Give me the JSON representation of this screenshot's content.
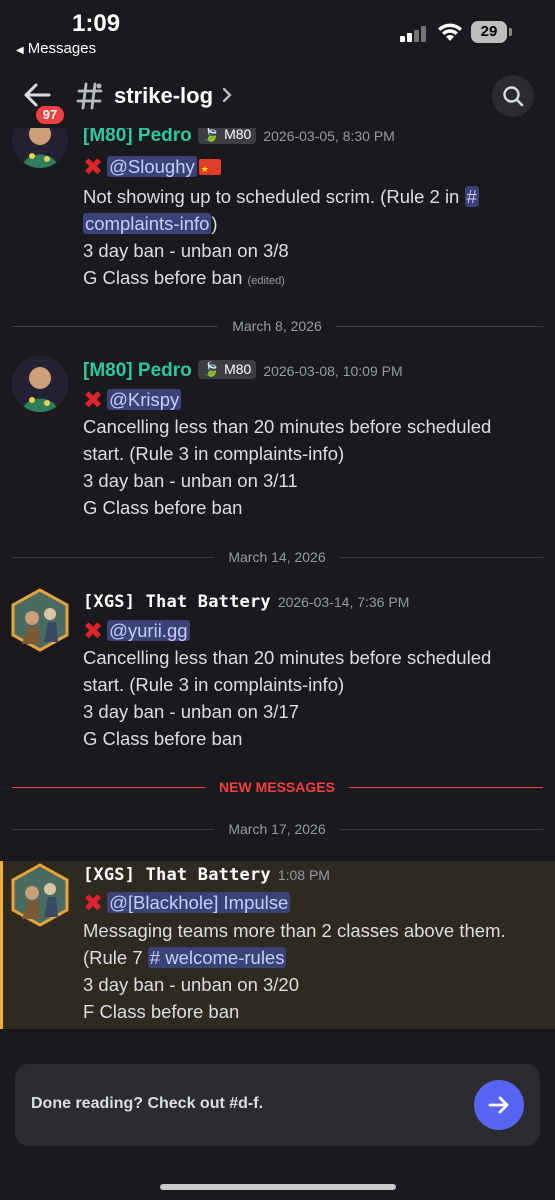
{
  "status_bar": {
    "time": "1:09",
    "back_app": "Messages",
    "battery": "29"
  },
  "header": {
    "unread_badge": "97",
    "channel_name": "strike-log"
  },
  "messages": [
    {
      "author": "[M80] Pedro",
      "tag": "M80",
      "timestamp": "2026-03-05, 8:30 PM",
      "mention": "@Sloughy",
      "line1_text": "Not showing up to scheduled scrim. (Rule 2 in ",
      "line1_channel": "#",
      "line2_channel": "complaints-info",
      "line2_suffix": ")",
      "line3": "3 day ban - unban on 3/8",
      "line4": "G Class before ban",
      "edited": "(edited)"
    },
    {
      "author": "[M80] Pedro",
      "tag": "M80",
      "timestamp": "2026-03-08, 10:09 PM",
      "mention": "@Krispy",
      "line1": "Cancelling less than 20 minutes before scheduled",
      "line2": "start. (Rule 3 in complaints-info)",
      "line3": "3 day ban - unban on 3/11",
      "line4": "G Class before ban"
    },
    {
      "author": "[XGS] That Battery",
      "timestamp": "2026-03-14, 7:36 PM",
      "mention": "@yurii.gg",
      "line1": "Cancelling less than 20 minutes before scheduled",
      "line2": "start. (Rule 3 in complaints-info)",
      "line3": "3 day ban - unban on 3/17",
      "line4": "G Class before ban"
    },
    {
      "author": "[XGS] That Battery",
      "timestamp": "1:08 PM",
      "mention": "@[Blackhole] Impulse",
      "line1": "Messaging teams more than 2 classes above them.",
      "line2_prefix": "(Rule 7 ",
      "line2_channel": "# welcome-rules",
      "line3": "3 day ban - unban on 3/20",
      "line4": "F Class before ban"
    }
  ],
  "dividers": {
    "d1": "March 8, 2026",
    "d2": "March 14, 2026",
    "new": "NEW MESSAGES",
    "d3": "March 17, 2026"
  },
  "composer": {
    "text": "Done reading? Check out #d-f."
  },
  "colors": {
    "background": "#1a1a1e",
    "accent": "#5865f2",
    "mention_bg": "#3c4278",
    "new_messages": "#f23f43",
    "highlight_border": "#f0b132",
    "author_green": "#2dc7a0"
  }
}
